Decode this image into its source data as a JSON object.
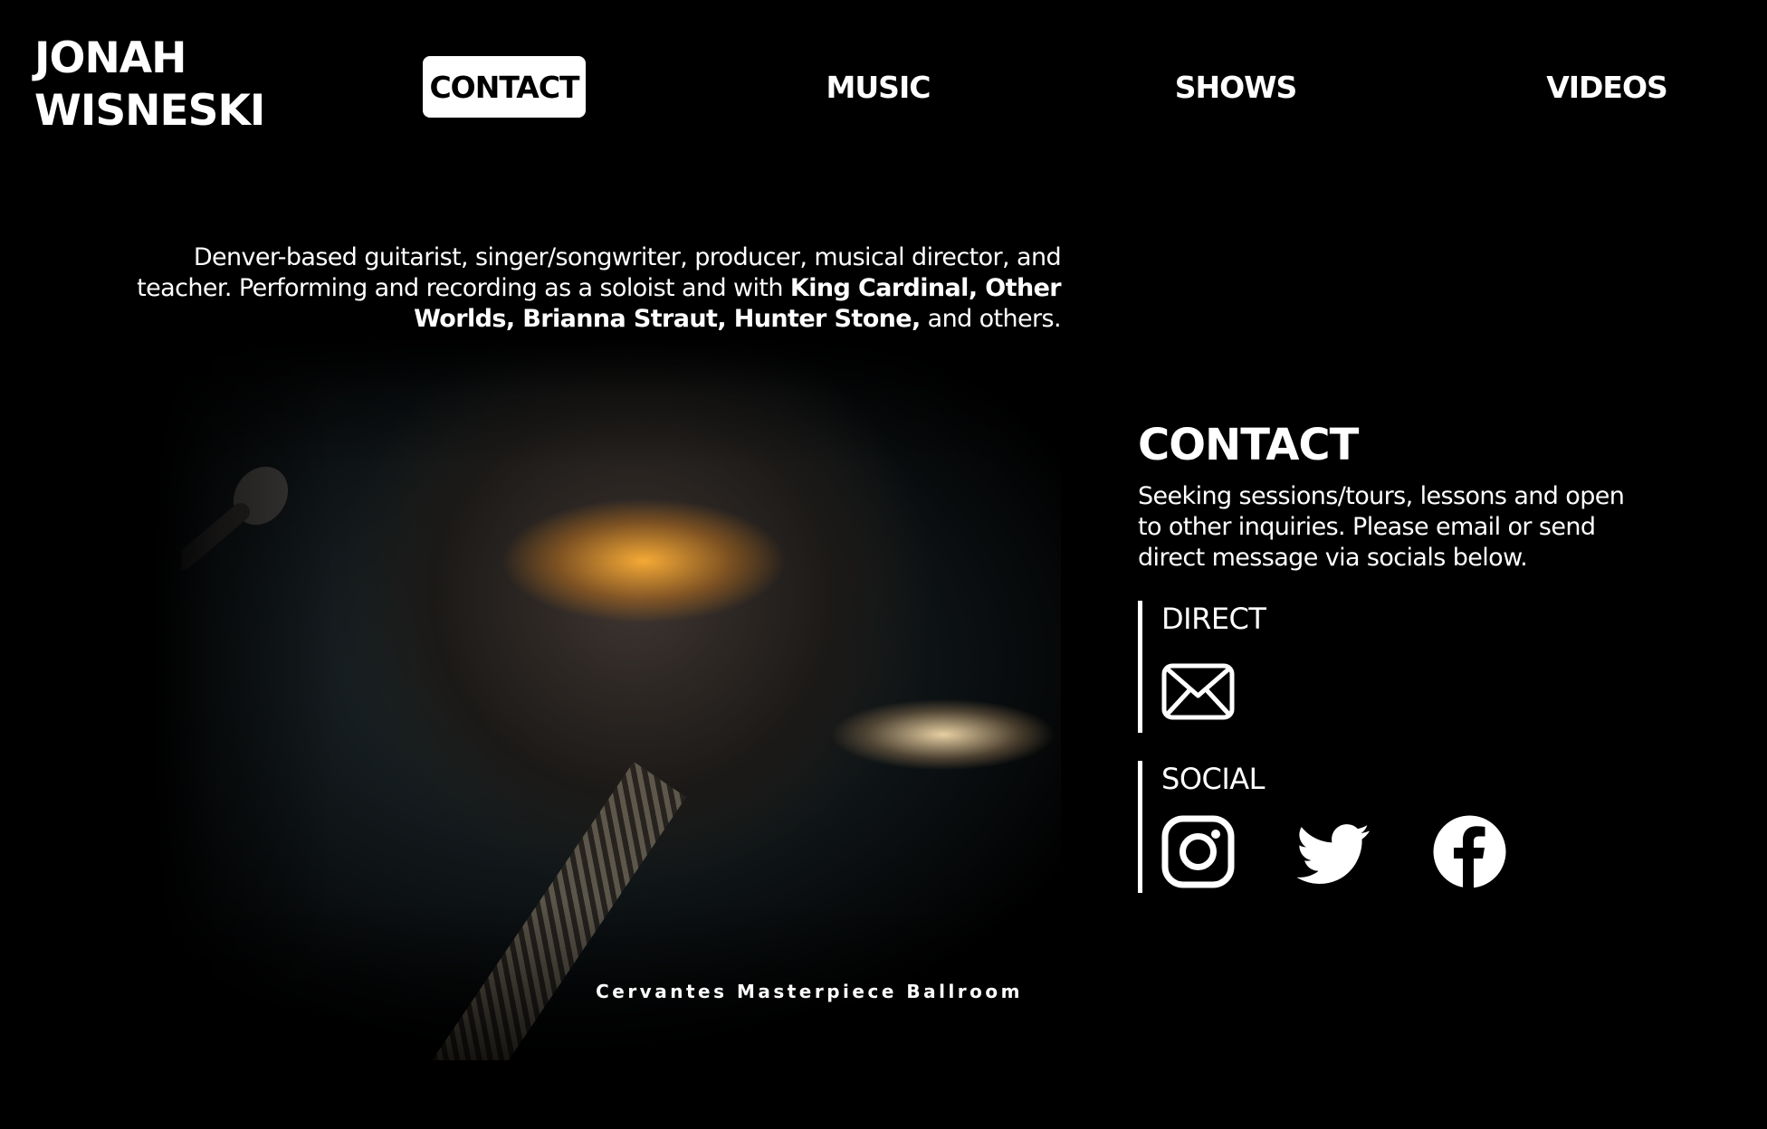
{
  "site": {
    "name_line1": "JONAH",
    "name_line2": "WISNESKI"
  },
  "nav": {
    "items": [
      {
        "label": "CONTACT",
        "active": true
      },
      {
        "label": "MUSIC",
        "active": false
      },
      {
        "label": "SHOWS",
        "active": false
      },
      {
        "label": "VIDEOS",
        "active": false
      }
    ]
  },
  "intro": {
    "text_1": "Denver-based guitarist, singer/songwriter, producer, musical director, and teacher. Performing and recording as a soloist and with ",
    "bold": "King Cardinal, Other Worlds, Brianna Straut, Hunter Stone,",
    "text_2": " and others."
  },
  "photo": {
    "caption": "Cervantes Masterpiece Ballroom"
  },
  "contact": {
    "heading": "CONTACT",
    "description": "Seeking sessions/tours, lessons and open to other inquiries. Please email or send direct message via socials below.",
    "direct": {
      "label": "DIRECT",
      "icons": [
        "envelope-icon"
      ]
    },
    "social": {
      "label": "SOCIAL",
      "icons": [
        "instagram-icon",
        "twitter-icon",
        "facebook-icon"
      ]
    }
  },
  "colors": {
    "background": "#000000",
    "text": "#ffffff",
    "active_nav_bg": "#ffffff",
    "active_nav_text": "#000000"
  }
}
